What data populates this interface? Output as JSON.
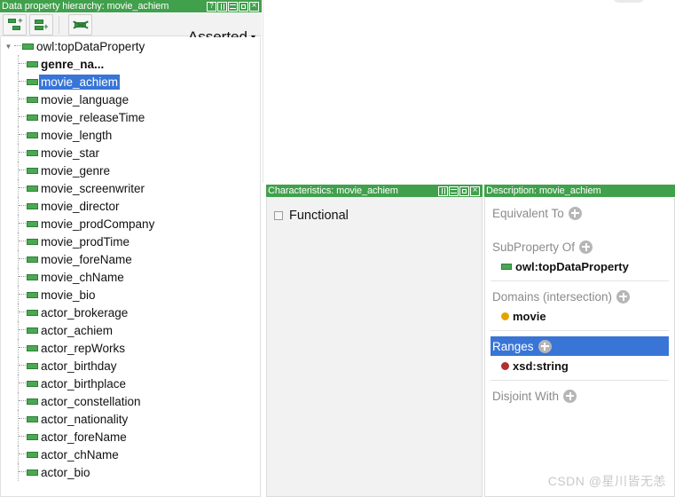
{
  "hierarchy": {
    "header": {
      "title": "Data property hierarchy: movie_achiem",
      "buttons": [
        {
          "name": "help-icon",
          "label": "?"
        },
        {
          "name": "split-icon",
          "label": ""
        },
        {
          "name": "minimize-icon",
          "label": ""
        },
        {
          "name": "maximize-icon",
          "label": ""
        },
        {
          "name": "close-icon",
          "label": "×"
        }
      ]
    },
    "toolbar": {
      "add_subproperty_tooltip": "Add sub property",
      "add_sibling_tooltip": "Add sibling property",
      "delete_tooltip": "Delete property",
      "view_selector": "Asserted",
      "view_caret": "▾"
    },
    "tree": [
      {
        "label": "owl:topDataProperty",
        "depth": 0,
        "bold": false,
        "selected": false,
        "expanded": true
      },
      {
        "label": "genre_na...",
        "depth": 1,
        "bold": true,
        "selected": false
      },
      {
        "label": "movie_achiem",
        "depth": 1,
        "bold": false,
        "selected": true
      },
      {
        "label": "movie_language",
        "depth": 1,
        "bold": false,
        "selected": false
      },
      {
        "label": "movie_releaseTime",
        "depth": 1,
        "bold": false,
        "selected": false
      },
      {
        "label": "movie_length",
        "depth": 1,
        "bold": false,
        "selected": false
      },
      {
        "label": "movie_star",
        "depth": 1,
        "bold": false,
        "selected": false
      },
      {
        "label": "movie_genre",
        "depth": 1,
        "bold": false,
        "selected": false
      },
      {
        "label": "movie_screenwriter",
        "depth": 1,
        "bold": false,
        "selected": false
      },
      {
        "label": "movie_director",
        "depth": 1,
        "bold": false,
        "selected": false
      },
      {
        "label": "movie_prodCompany",
        "depth": 1,
        "bold": false,
        "selected": false
      },
      {
        "label": "movie_prodTime",
        "depth": 1,
        "bold": false,
        "selected": false
      },
      {
        "label": "movie_foreName",
        "depth": 1,
        "bold": false,
        "selected": false
      },
      {
        "label": "movie_chName",
        "depth": 1,
        "bold": false,
        "selected": false
      },
      {
        "label": "movie_bio",
        "depth": 1,
        "bold": false,
        "selected": false
      },
      {
        "label": "actor_brokerage",
        "depth": 1,
        "bold": false,
        "selected": false
      },
      {
        "label": "actor_achiem",
        "depth": 1,
        "bold": false,
        "selected": false
      },
      {
        "label": "actor_repWorks",
        "depth": 1,
        "bold": false,
        "selected": false
      },
      {
        "label": "actor_birthday",
        "depth": 1,
        "bold": false,
        "selected": false
      },
      {
        "label": "actor_birthplace",
        "depth": 1,
        "bold": false,
        "selected": false
      },
      {
        "label": "actor_constellation",
        "depth": 1,
        "bold": false,
        "selected": false
      },
      {
        "label": "actor_nationality",
        "depth": 1,
        "bold": false,
        "selected": false
      },
      {
        "label": "actor_foreName",
        "depth": 1,
        "bold": false,
        "selected": false
      },
      {
        "label": "actor_chName",
        "depth": 1,
        "bold": false,
        "selected": false
      },
      {
        "label": "actor_bio",
        "depth": 1,
        "bold": false,
        "selected": false
      }
    ]
  },
  "characteristics": {
    "header": {
      "title": "Characteristics: movie_achiem",
      "buttons": [
        {
          "name": "split-icon",
          "label": ""
        },
        {
          "name": "minimize-icon",
          "label": ""
        },
        {
          "name": "maximize-icon",
          "label": ""
        },
        {
          "name": "close-icon",
          "label": "×"
        }
      ]
    },
    "options": [
      {
        "label": "Functional",
        "checked": false
      }
    ]
  },
  "description": {
    "header": {
      "title": "Description: movie_achiem"
    },
    "sections": [
      {
        "title": "Equivalent To",
        "active": false,
        "items": []
      },
      {
        "title": "SubProperty Of",
        "active": false,
        "items": [
          {
            "label": "owl:topDataProperty",
            "icon": "data-property-icon",
            "color": "#4aa852"
          }
        ]
      },
      {
        "title": "Domains (intersection)",
        "active": false,
        "items": [
          {
            "label": "movie",
            "icon": "class-icon",
            "color": "#e0a400"
          }
        ]
      },
      {
        "title": "Ranges",
        "active": true,
        "items": [
          {
            "label": "xsd:string",
            "icon": "datatype-icon",
            "color": "#b03030"
          }
        ]
      },
      {
        "title": "Disjoint With",
        "active": false,
        "items": []
      }
    ]
  },
  "watermark": {
    "text": "CSDN @星川皆无恙"
  },
  "colors": {
    "panel_header_green": "#41a04c",
    "selection_blue": "#3875d7",
    "property_green": "#4aa852",
    "class_yellow": "#e0a400",
    "datatype_red": "#b03030"
  }
}
